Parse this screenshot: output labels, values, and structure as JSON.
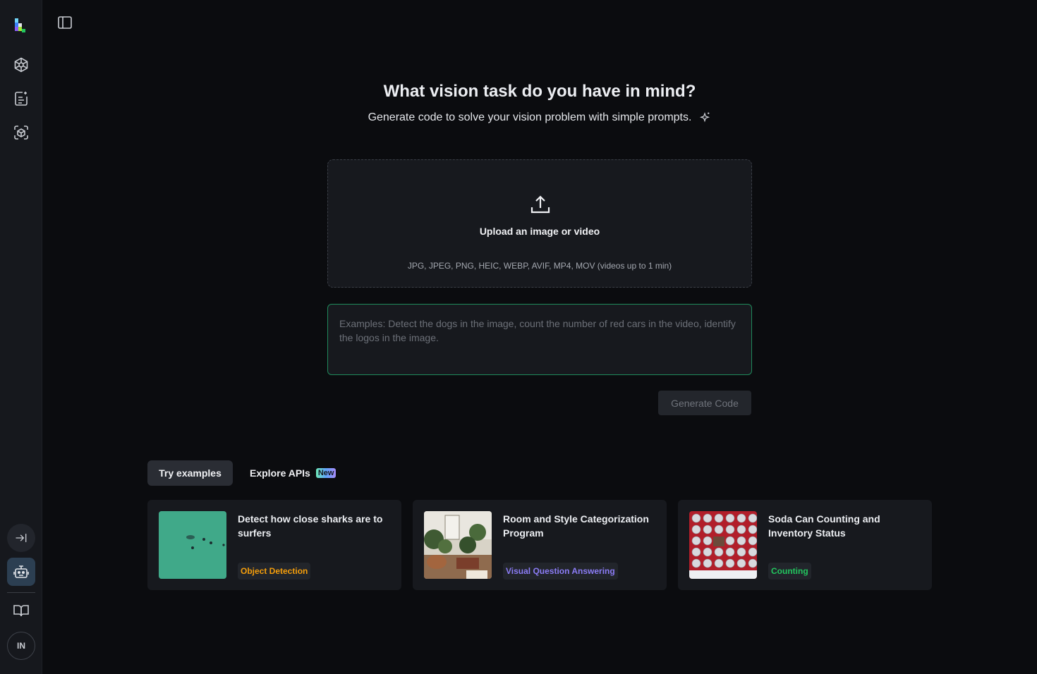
{
  "header": {
    "title": "What vision task do you have in mind?",
    "subtitle": "Generate code to solve your vision problem with simple prompts."
  },
  "sidebar": {
    "items": [
      {
        "name": "logo",
        "icon": "landing-logo-icon"
      },
      {
        "name": "models",
        "icon": "hexagon-network-icon"
      },
      {
        "name": "agent-docs",
        "icon": "document-sparkle-icon"
      },
      {
        "name": "3d-vision",
        "icon": "cube-scan-icon"
      },
      {
        "name": "collapse",
        "icon": "arrow-right-to-line-icon"
      },
      {
        "name": "agent",
        "icon": "robot-icon"
      },
      {
        "name": "docs",
        "icon": "open-book-icon"
      }
    ],
    "avatar_initials": "IN"
  },
  "upload": {
    "label": "Upload an image or video",
    "formats": "JPG, JPEG, PNG, HEIC, WEBP, AVIF, MP4, MOV (videos up to 1 min)"
  },
  "prompt": {
    "placeholder": "Examples: Detect the dogs in the image, count the number of red cars in the video, identify the logos in the image.",
    "value": ""
  },
  "generate_button": "Generate Code",
  "tabs": [
    {
      "label": "Try examples",
      "active": true
    },
    {
      "label": "Explore APIs",
      "badge": "New",
      "active": false
    }
  ],
  "examples": [
    {
      "title": "Detect how close sharks are to surfers",
      "tag": "Object Detection",
      "tag_color": "#f59e0b"
    },
    {
      "title": "Room and Style Categorization Program",
      "tag": "Visual Question Answering",
      "tag_color": "#8b7cf6"
    },
    {
      "title": "Soda Can Counting and Inventory Status",
      "tag": "Counting",
      "tag_color": "#22c55e"
    }
  ],
  "colors": {
    "background": "#0b0c0f",
    "sidebar": "#16181d",
    "accent_border": "#1f8a5b"
  }
}
